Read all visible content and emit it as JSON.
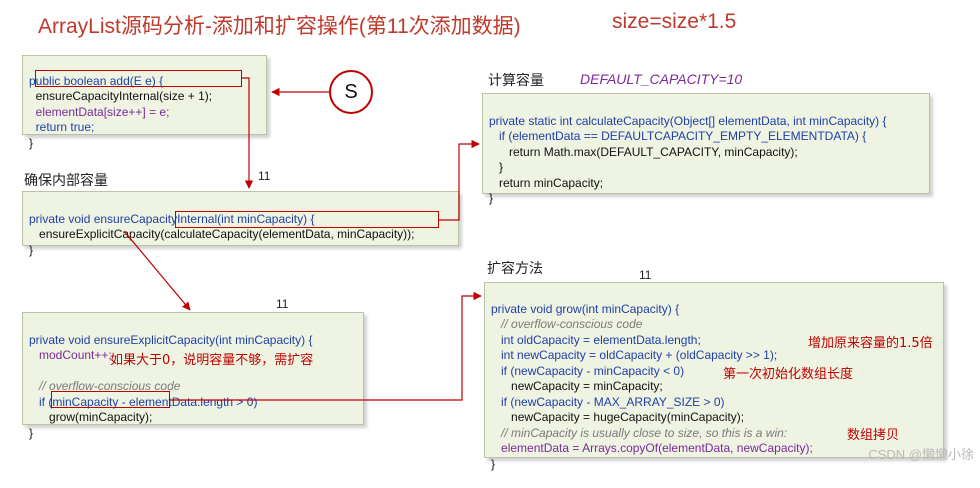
{
  "title": "ArrayList源码分析-添加和扩容操作(第11次添加数据)",
  "formula": "size=size*1.5",
  "labels": {
    "compute": "计算容量",
    "default_capacity": "DEFAULT_CAPACITY=10",
    "ensure_internal": "确保内部容量",
    "grow_method": "扩容方法"
  },
  "step_numbers": {
    "ensure_internal": "11",
    "ensure_explicit": "11",
    "grow": "11"
  },
  "circle_marker": "S",
  "code": {
    "add": [
      "public boolean add(E e) {",
      "ensureCapacityInternal(size + 1);",
      "elementData[size++] = e;",
      "return true;",
      "}"
    ],
    "calc": [
      "private static int calculateCapacity(Object[] elementData, int minCapacity) {",
      "if (elementData == DEFAULTCAPACITY_EMPTY_ELEMENTDATA) {",
      "return Math.max(DEFAULT_CAPACITY, minCapacity);",
      "}",
      "return minCapacity;",
      "}"
    ],
    "ensure_internal": [
      "private void ensureCapacityInternal(int minCapacity) {",
      "ensureExplicitCapacity(calculateCapacity(elementData, minCapacity));",
      "}"
    ],
    "ensure_explicit": [
      "private void ensureExplicitCapacity(int minCapacity) {",
      "modCount++;",
      "// overflow-conscious code",
      "if (minCapacity - elementData.length > 0)",
      "grow(minCapacity);",
      "}"
    ],
    "grow": [
      "private void grow(int minCapacity) {",
      "// overflow-conscious code",
      "int oldCapacity = elementData.length;",
      "int newCapacity = oldCapacity + (oldCapacity >> 1);",
      "if (newCapacity - minCapacity < 0)",
      "newCapacity = minCapacity;",
      "if (newCapacity - MAX_ARRAY_SIZE > 0)",
      "newCapacity = hugeCapacity(minCapacity);",
      "// minCapacity is usually close to size, so this is a win:",
      "elementData = Arrays.copyOf(elementData, newCapacity);",
      "}"
    ]
  },
  "notes": {
    "need_grow": "如果大于0，说明容量不够，需扩容",
    "increase": "增加原来容量的1.5倍",
    "first_init": "第一次初始化数组长度",
    "copy": "数组拷贝"
  },
  "watermark": "CSDN @懒懒小徐",
  "colors": {
    "accent_red": "#c00000",
    "keyword_blue": "#1f3fa8",
    "field_purple": "#7b2a9a",
    "box_background": "#eef3e2"
  }
}
